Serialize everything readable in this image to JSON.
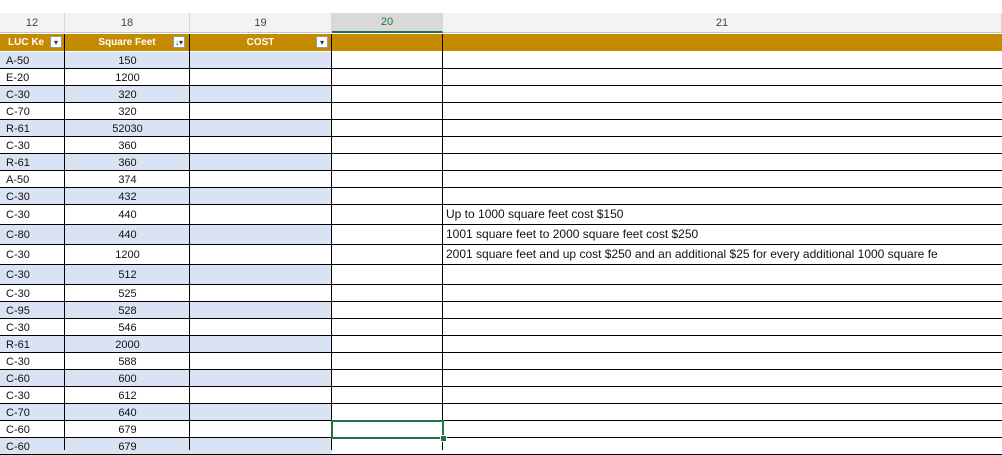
{
  "column_headers": [
    "12",
    "18",
    "19",
    "20",
    "21"
  ],
  "selected_column": "20",
  "table_headers": {
    "luc_key": "LUC Ke",
    "square_feet": "Square Feet",
    "cost": "COST"
  },
  "filter_icons": {
    "luc_key": "filter-dropdown-icon",
    "square_feet": "sort-ascending-filter-icon",
    "cost": "filter-dropdown-icon"
  },
  "colors": {
    "header_fill": "#c48a00",
    "band_fill": "#dae3f3",
    "selection_accent": "#217346"
  },
  "rows": [
    {
      "luc": "A-50",
      "sqft": "150"
    },
    {
      "luc": "E-20",
      "sqft": "1200"
    },
    {
      "luc": "C-30",
      "sqft": "320"
    },
    {
      "luc": "C-70",
      "sqft": "320"
    },
    {
      "luc": "R-61",
      "sqft": "52030"
    },
    {
      "luc": "C-30",
      "sqft": "360"
    },
    {
      "luc": "R-61",
      "sqft": "360"
    },
    {
      "luc": "A-50",
      "sqft": "374"
    },
    {
      "luc": "C-30",
      "sqft": "432"
    },
    {
      "luc": "C-30",
      "sqft": "440"
    },
    {
      "luc": "C-80",
      "sqft": "440"
    },
    {
      "luc": "C-30",
      "sqft": "1200"
    },
    {
      "luc": "C-30",
      "sqft": "512"
    },
    {
      "luc": "C-30",
      "sqft": "525"
    },
    {
      "luc": "C-95",
      "sqft": "528"
    },
    {
      "luc": "C-30",
      "sqft": "546"
    },
    {
      "luc": "R-61",
      "sqft": "2000"
    },
    {
      "luc": "C-30",
      "sqft": "588"
    },
    {
      "luc": "C-60",
      "sqft": "600"
    },
    {
      "luc": "C-30",
      "sqft": "612"
    },
    {
      "luc": "C-70",
      "sqft": "640"
    },
    {
      "luc": "C-60",
      "sqft": "679"
    },
    {
      "luc": "C-60",
      "sqft": "679"
    }
  ],
  "notes": [
    "Up to 1000 square feet cost $150",
    "1001 square feet to 2000 square feet cost $250",
    " 2001 square feet and up cost $250 and an additional $25 for every additional 1000 square fe"
  ]
}
